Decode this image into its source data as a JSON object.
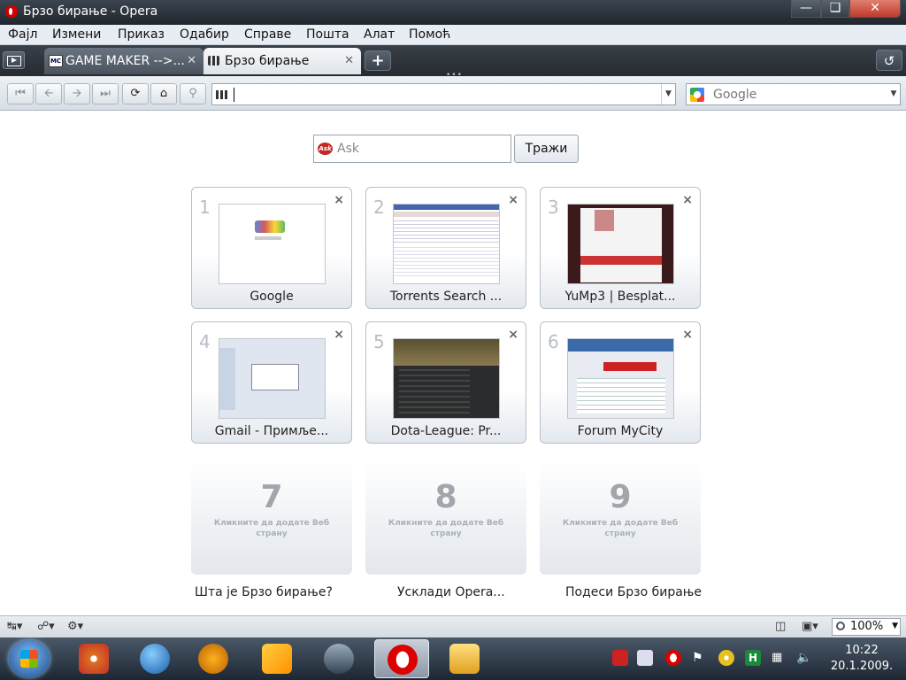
{
  "window": {
    "title": "Брзо бирање - Opera"
  },
  "menu": [
    "Фајл",
    "Измени",
    "Приказ",
    "Одабир",
    "Справе",
    "Пошта",
    "Алат",
    "Помоћ"
  ],
  "tabs": [
    {
      "label": "GAME MAKER -->...",
      "favicon": "MC",
      "active": false
    },
    {
      "label": "Брзо бирање",
      "active": true
    }
  ],
  "address": {
    "value": ""
  },
  "search_engine": {
    "name": "Google"
  },
  "ask": {
    "placeholder": "Ask",
    "button": "Тражи",
    "logo_text": "Ask"
  },
  "dials": [
    {
      "number": "1",
      "label": "Google"
    },
    {
      "number": "2",
      "label": "Torrents Search ..."
    },
    {
      "number": "3",
      "label": "YuMp3 | Besplat..."
    },
    {
      "number": "4",
      "label": "Gmail - Примље..."
    },
    {
      "number": "5",
      "label": "Dota-League: Pr..."
    },
    {
      "number": "6",
      "label": "Forum MyCity"
    },
    {
      "number": "7",
      "hint": "Кликните да додате Веб страну"
    },
    {
      "number": "8",
      "hint": "Кликните да додате Веб страну"
    },
    {
      "number": "9",
      "hint": "Кликните да додате Веб страну"
    }
  ],
  "footer_links": [
    "Шта је Брзо бирање?",
    "Усклади Opera...",
    "Подеси Брзо бирање"
  ],
  "status": {
    "zoom": "100%"
  },
  "clock": {
    "time": "10:22",
    "date": "20.1.2009."
  },
  "colors": {
    "opera_red": "#cc0000",
    "chrome_dark": "#262b31",
    "taskbar": "#1d2733"
  }
}
